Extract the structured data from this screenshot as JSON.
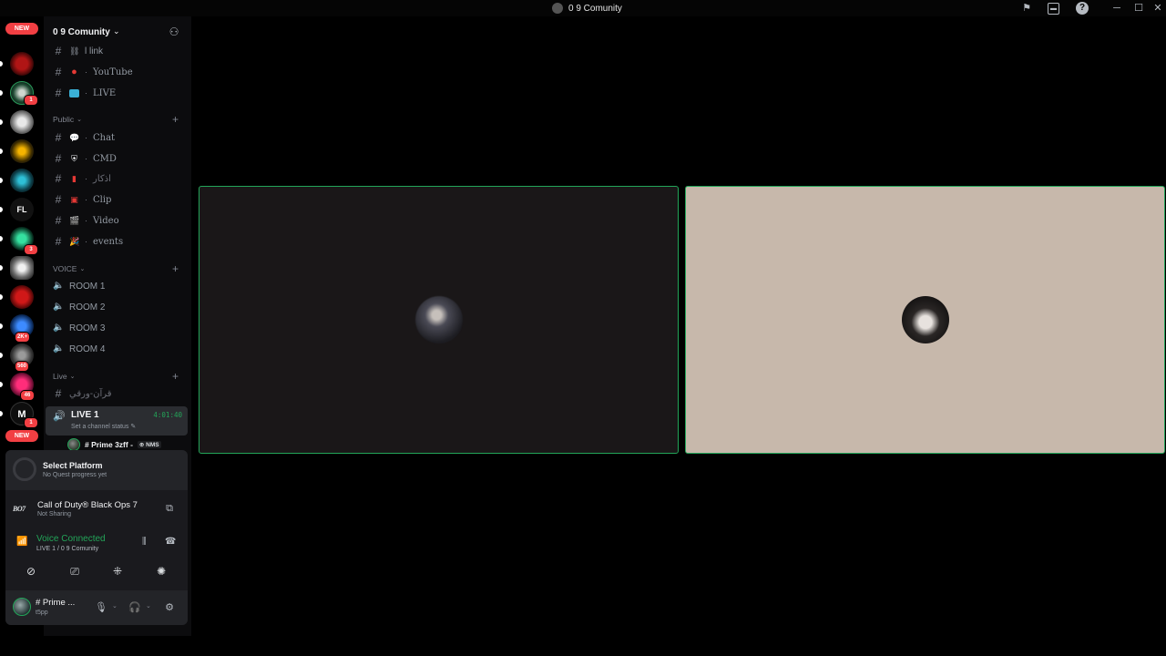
{
  "window": {
    "title": "0 9 Comunity",
    "icons": [
      "flag-icon",
      "inbox-icon",
      "help-icon"
    ],
    "controls": [
      "minimize",
      "maximize",
      "close"
    ]
  },
  "server_rail": {
    "new_top": "NEW",
    "new_bottom": "NEW",
    "badges": [
      "1",
      "3",
      "2K+",
      "560",
      "46",
      "1"
    ],
    "fl_label": "FL"
  },
  "guild": {
    "name": "0 9 Comunity"
  },
  "channels": {
    "top": [
      {
        "label": "l link",
        "icon": "link-icon",
        "icon_color": "#949ba4"
      },
      {
        "label": "YouTube",
        "icon": "red-circle-icon",
        "icon_color": "#e53935"
      },
      {
        "label": "LIVE",
        "icon": "live-tv-icon",
        "icon_color": "#3ab0d6"
      }
    ],
    "public_category": "Public",
    "public": [
      {
        "label": "Chat",
        "icon": "speech-bubble-icon"
      },
      {
        "label": "CMD",
        "icon": "shield-icon"
      },
      {
        "label": "اذكار",
        "icon": "prayer-icon"
      },
      {
        "label": "Clip",
        "icon": "film-icon"
      },
      {
        "label": "Video",
        "icon": "clapper-icon"
      },
      {
        "label": "events",
        "icon": "party-popper-icon"
      }
    ],
    "voice_category": "VOICE",
    "voice": [
      "ROOM 1",
      "ROOM 2",
      "ROOM 3",
      "ROOM 4"
    ],
    "live_category": "Live",
    "live_text_channel": "قرآن-ورقي",
    "live_voice": {
      "name": "LIVE 1",
      "elapsed": "4:01:40",
      "status": "Set a channel status"
    },
    "participant": {
      "name": "# Prime 3zff -",
      "tag": "NMS"
    }
  },
  "quest": {
    "title": "Select Platform",
    "subtitle": "No Quest progress yet"
  },
  "activity": {
    "game_badge": "BO7",
    "title": "Call of Duty® Black Ops 7",
    "subtitle": "Not Sharing"
  },
  "voice": {
    "status": "Voice Connected",
    "location": "LIVE 1 / 0 9 Comunity",
    "accent": "#23a559"
  },
  "user": {
    "name": "# Prime ...",
    "subtext": "t5pp"
  },
  "stage": {
    "tiles": [
      {
        "id": "left",
        "background": "#1a1718"
      },
      {
        "id": "right",
        "background": "#c7b8ab"
      }
    ],
    "speaking_border": "#23a559"
  }
}
